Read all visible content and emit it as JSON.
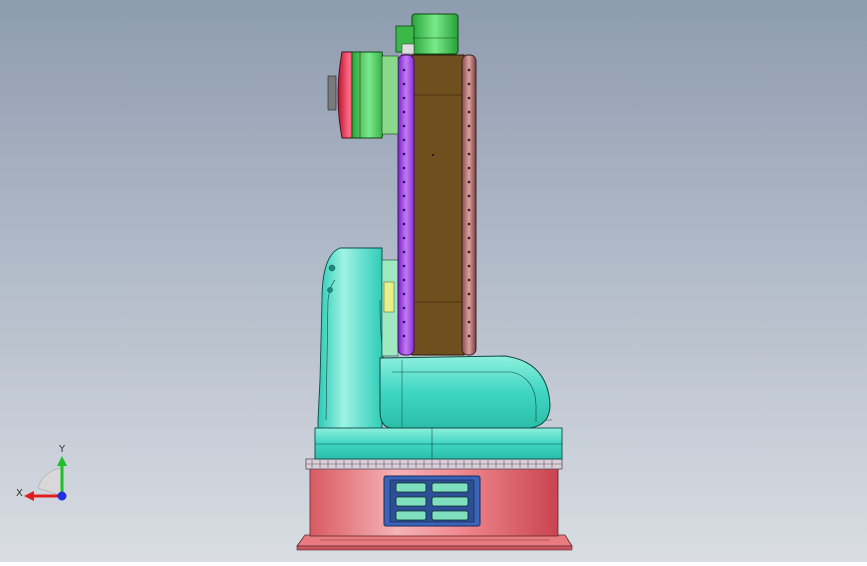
{
  "viewport": {
    "background_top": "#8e9cb0",
    "background_bottom": "#d9dde3"
  },
  "colors": {
    "base": "#e8737a",
    "base_highlight": "#f7c2c4",
    "cyan_body": "#3fd6c2",
    "cyan_light": "#aef5e8",
    "arm_brown": "#6e4f1e",
    "arm_purple": "#9a3fe0",
    "arm_mauve": "#b46a6a",
    "motor_green": "#35c24a",
    "wrist_red": "#e8204a",
    "panel_blue": "#3a64b8"
  },
  "triad": {
    "x_label": "X",
    "y_label": "Y",
    "x_color": "#e21f1f",
    "y_color": "#1fbf2a",
    "z_color": "#2030e0"
  }
}
